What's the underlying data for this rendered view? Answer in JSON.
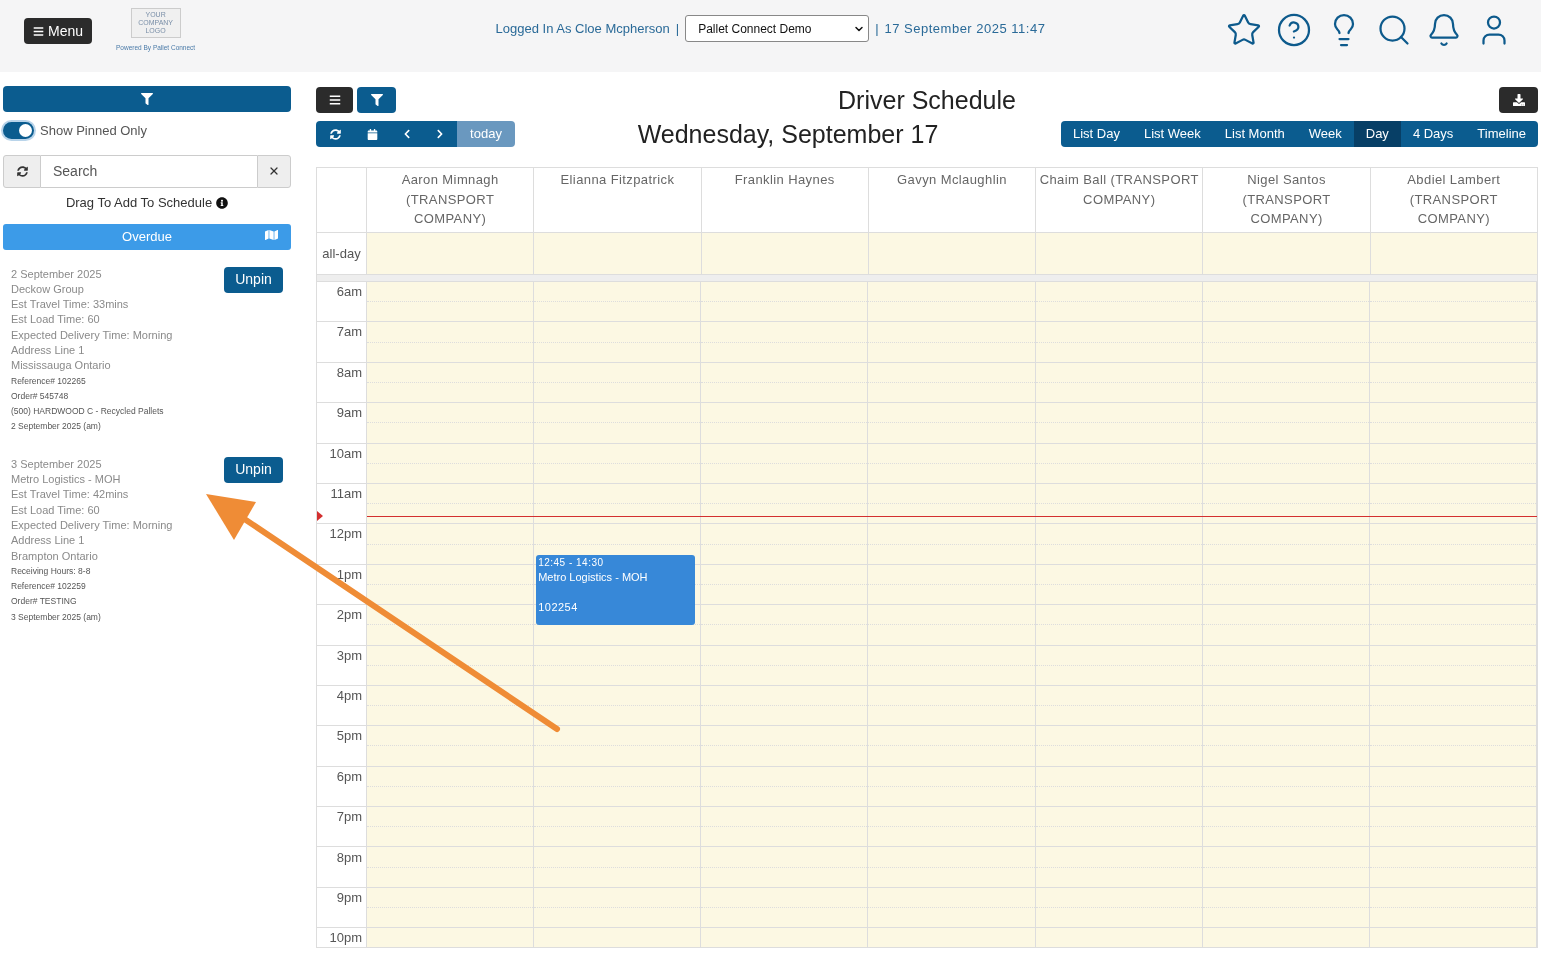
{
  "header": {
    "menu_button": "Menu",
    "logo": {
      "lines": [
        "YOUR",
        "COMPANY",
        "LOGO"
      ],
      "caption": "Powered By Pallet Connect"
    },
    "user_text": "Logged In As Cloe Mcpherson",
    "separator_left": "|",
    "company_select": {
      "value": "Pallet Connect Demo"
    },
    "separator_right": "|",
    "datetime": "17 September 2025 11:47"
  },
  "sidebar": {
    "pin_toggle": {
      "label": "Show Pinned Only",
      "on": true
    },
    "search": {
      "placeholder": "Search"
    },
    "drag_hint": "Drag To Add To Schedule",
    "section": {
      "title": "Overdue"
    },
    "orders": [
      {
        "lines": [
          {
            "kind": "main",
            "text": "2 September 2025"
          },
          {
            "kind": "main",
            "text": "Deckow Group"
          },
          {
            "kind": "main",
            "text": "Est Travel Time: 33mins"
          },
          {
            "kind": "main",
            "text": "Est Load Time: 60"
          },
          {
            "kind": "main",
            "text": "Expected Delivery Time: Morning"
          },
          {
            "kind": "main",
            "text": "Address Line 1"
          },
          {
            "kind": "main",
            "text": "Mississauga Ontario"
          },
          {
            "kind": "small",
            "text": "Reference# 102265"
          },
          {
            "kind": "small",
            "text": "Order# 545748"
          },
          {
            "kind": "small",
            "text": "(500) HARDWOOD C - Recycled Pallets"
          },
          {
            "kind": "small",
            "text": "2 September 2025 (am)"
          }
        ],
        "button": "Unpin"
      },
      {
        "lines": [
          {
            "kind": "main",
            "text": "3 September 2025"
          },
          {
            "kind": "main",
            "text": "Metro Logistics - MOH"
          },
          {
            "kind": "main",
            "text": "Est Travel Time: 42mins"
          },
          {
            "kind": "main",
            "text": "Est Load Time: 60"
          },
          {
            "kind": "main",
            "text": "Expected Delivery Time: Morning"
          },
          {
            "kind": "main",
            "text": "Address Line 1"
          },
          {
            "kind": "main",
            "text": "Brampton Ontario"
          },
          {
            "kind": "small",
            "text": "Receiving Hours: 8-8"
          },
          {
            "kind": "small",
            "text": "Reference# 102259"
          },
          {
            "kind": "small",
            "text": "Order# TESTING"
          },
          {
            "kind": "small",
            "text": "3 September 2025 (am)"
          }
        ],
        "button": "Unpin"
      }
    ]
  },
  "schedule": {
    "title": "Driver Schedule",
    "date_title": "Wednesday, September 17",
    "today_button": {
      "label": "today",
      "disabled": true
    },
    "views": [
      {
        "label": "List Day",
        "selected": false
      },
      {
        "label": "List Week",
        "selected": false
      },
      {
        "label": "List Month",
        "selected": false
      },
      {
        "label": "Week",
        "selected": false
      },
      {
        "label": "Day",
        "selected": true
      },
      {
        "label": "4 Days",
        "selected": false
      },
      {
        "label": "Timeline",
        "selected": false
      }
    ]
  },
  "calendar": {
    "all_day_label": "all-day",
    "hours": [
      "6am",
      "7am",
      "8am",
      "9am",
      "10am",
      "11am",
      "12pm",
      "1pm",
      "2pm",
      "3pm",
      "4pm",
      "5pm",
      "6pm",
      "7pm",
      "8pm",
      "9pm",
      "10pm"
    ],
    "resources": [
      {
        "name": "Aaron Mimnagh (TRANSPORT COMPANY)"
      },
      {
        "name": "Elianna Fitzpatrick",
        "events": [
          {
            "time": "12:45 - 14:30",
            "title": "Metro Logistics - MOH",
            "reference": "102254"
          }
        ]
      },
      {
        "name": "Franklin Haynes"
      },
      {
        "name": "Gavyn Mclaughlin"
      },
      {
        "name": "Chaim Ball (TRANSPORT COMPANY)"
      },
      {
        "name": "Nigel Santos (TRANSPORT COMPANY)"
      },
      {
        "name": "Abdiel Lambert (TRANSPORT COMPANY)"
      }
    ]
  }
}
